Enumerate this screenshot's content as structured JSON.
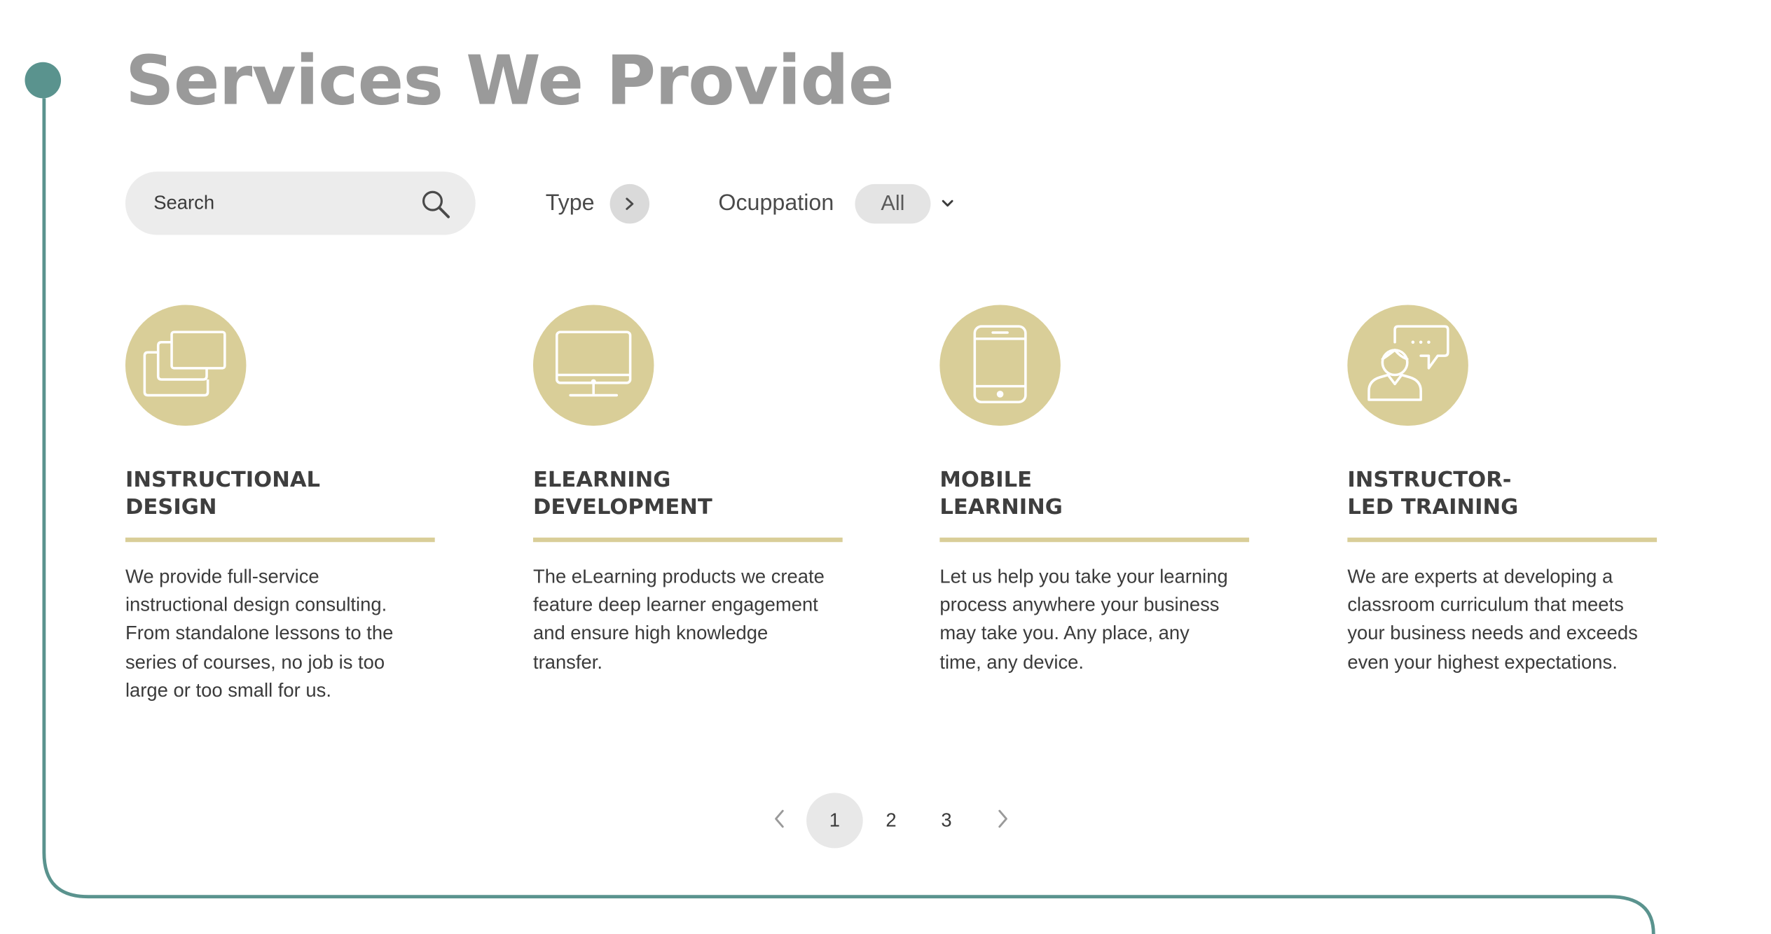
{
  "header": {
    "title": "Services We Provide"
  },
  "filters": {
    "search_placeholder": "Search",
    "type_label": "Type",
    "occupation_label": "Ocuppation",
    "occupation_value": "All"
  },
  "services": [
    {
      "icon": "stacked-windows-icon",
      "title": "INSTRUCTIONAL\nDESIGN",
      "description": "We provide full-service instructional design consulting. From standalone lessons to the series of courses, no job is too large or too small for us."
    },
    {
      "icon": "desktop-monitor-icon",
      "title": "ELEARNING\nDEVELOPMENT",
      "description": "The eLearning products we create feature deep learner engagement and ensure high knowledge transfer."
    },
    {
      "icon": "smartphone-icon",
      "title": "MOBILE\nLEARNING",
      "description": "Let us help you take your learning process anywhere your business may take you. Any place, any time, any device."
    },
    {
      "icon": "instructor-speech-icon",
      "title": "INSTRUCTOR-\nLED TRAINING",
      "description": "We are experts at developing a classroom curriculum that meets your business needs and exceeds even your highest expectations."
    }
  ],
  "pagination": {
    "pages": [
      "1",
      "2",
      "3"
    ],
    "current": "1"
  },
  "colors": {
    "accent_teal": "#5a938e",
    "icon_gold": "#d9ce98",
    "title_gray": "#9a9a9a"
  }
}
